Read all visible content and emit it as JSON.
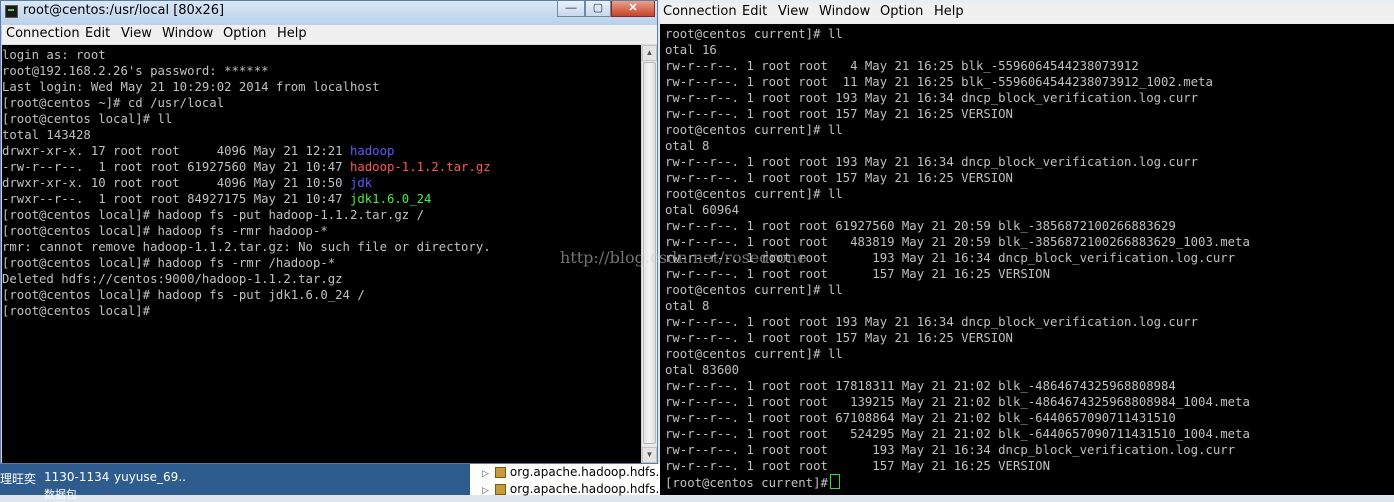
{
  "background_tabs": [],
  "left_window": {
    "title": "root@centos:/usr/local [80x26]",
    "controls": {
      "minimize": "—",
      "maximize": "▢",
      "close": "✕"
    },
    "menu": [
      "Connection",
      "Edit",
      "View",
      "Window",
      "Option",
      "Help"
    ],
    "lines": [
      {
        "text": "login as: root"
      },
      {
        "text": "root@192.168.2.26's password: ******"
      },
      {
        "text": "Last login: Wed May 21 10:29:02 2014 from localhost"
      },
      {
        "text": "[root@centos ~]# cd /usr/local"
      },
      {
        "text": "[root@centos local]# ll"
      },
      {
        "text": "total 143428"
      },
      {
        "text": "drwxr-xr-x. 17 root root     4096 May 21 12:21 ",
        "name": "hadoop",
        "name_color": "#5a5aff"
      },
      {
        "text": "-rw-r--r--.  1 root root 61927560 May 21 10:47 ",
        "name": "hadoop-1.1.2.tar.gz",
        "name_color": "#ff5555"
      },
      {
        "text": "drwxr-xr-x. 10 root root     4096 May 21 10:50 ",
        "name": "jdk",
        "name_color": "#5a5aff"
      },
      {
        "text": "-rwxr--r--.  1 root root 84927175 May 21 10:47 ",
        "name": "jdk1.6.0_24",
        "name_color": "#44ee44"
      },
      {
        "text": "[root@centos local]# hadoop fs -put hadoop-1.1.2.tar.gz /"
      },
      {
        "text": "[root@centos local]# hadoop fs -rmr hadoop-*"
      },
      {
        "text": "rmr: cannot remove hadoop-1.1.2.tar.gz: No such file or directory."
      },
      {
        "text": "[root@centos local]# hadoop fs -rmr /hadoop-*"
      },
      {
        "text": "Deleted hdfs://centos:9000/hadoop-1.1.2.tar.gz"
      },
      {
        "text": "[root@centos local]# hadoop fs -put jdk1.6.0_24 /"
      },
      {
        "text": "[root@centos local]#"
      }
    ]
  },
  "right_window": {
    "menu": [
      "Connection",
      "Edit",
      "View",
      "Window",
      "Option",
      "Help"
    ],
    "lines": [
      "root@centos current]# ll",
      "otal 16",
      "rw-r--r--. 1 root root   4 May 21 16:25 blk_-5596064544238073912",
      "rw-r--r--. 1 root root  11 May 21 16:25 blk_-5596064544238073912_1002.meta",
      "rw-r--r--. 1 root root 193 May 21 16:34 dncp_block_verification.log.curr",
      "rw-r--r--. 1 root root 157 May 21 16:25 VERSION",
      "root@centos current]# ll",
      "otal 8",
      "rw-r--r--. 1 root root 193 May 21 16:34 dncp_block_verification.log.curr",
      "rw-r--r--. 1 root root 157 May 21 16:25 VERSION",
      "root@centos current]# ll",
      "otal 60964",
      "rw-r--r--. 1 root root 61927560 May 21 20:59 blk_-3856872100266883629",
      "rw-r--r--. 1 root root   483819 May 21 20:59 blk_-3856872100266883629_1003.meta",
      "rw-r--r--. 1 root root      193 May 21 16:34 dncp_block_verification.log.curr",
      "rw-r--r--. 1 root root      157 May 21 16:25 VERSION",
      "root@centos current]# ll",
      "otal 8",
      "rw-r--r--. 1 root root 193 May 21 16:34 dncp_block_verification.log.curr",
      "rw-r--r--. 1 root root 157 May 21 16:25 VERSION",
      "root@centos current]# ll",
      "otal 83600",
      "rw-r--r--. 1 root root 17818311 May 21 21:02 blk_-4864674325968808984",
      "rw-r--r--. 1 root root   139215 May 21 21:02 blk_-4864674325968808984_1004.meta",
      "rw-r--r--. 1 root root 67108864 May 21 21:02 blk_-6440657090711431510",
      "rw-r--r--. 1 root root   524295 May 21 21:02 blk_-6440657090711431510_1004.meta",
      "rw-r--r--. 1 root root      193 May 21 16:34 dncp_block_verification.log.curr",
      "rw-r--r--. 1 root root      157 May 21 16:25 VERSION",
      "[root@centos current]#"
    ]
  },
  "watermark": "http://blog.csdn.net/rosedrone",
  "taskbar": {
    "items": [
      "理旺奕",
      "1130-1134",
      "yuyuse_69..",
      "数据包"
    ]
  },
  "tree": {
    "items": [
      "org.apache.hadoop.hdfs.",
      "org.apache.hadoop.hdfs."
    ]
  },
  "colors": {
    "terminal_bg": "#000000",
    "terminal_fg": "#c0c0c0",
    "dir_blue": "#5a5aff",
    "archive_red": "#ff5555",
    "exec_green": "#44ee44"
  }
}
